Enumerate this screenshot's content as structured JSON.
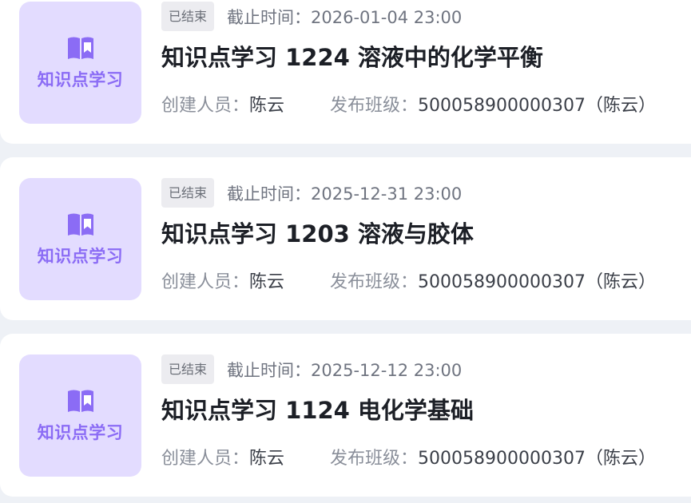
{
  "cards": [
    {
      "thumb_label": "知识点学习",
      "status": "已结束",
      "deadline_label": "截止时间：",
      "deadline": "2026-01-04 23:00",
      "title": "知识点学习 1224 溶液中的化学平衡",
      "creator_label": "创建人员：",
      "creator": "陈云",
      "class_label": "发布班级：",
      "class_value": "500058900000307（陈云）"
    },
    {
      "thumb_label": "知识点学习",
      "status": "已结束",
      "deadline_label": "截止时间：",
      "deadline": "2025-12-31 23:00",
      "title": "知识点学习 1203 溶液与胶体",
      "creator_label": "创建人员：",
      "creator": "陈云",
      "class_label": "发布班级：",
      "class_value": "500058900000307（陈云）"
    },
    {
      "thumb_label": "知识点学习",
      "status": "已结束",
      "deadline_label": "截止时间：",
      "deadline": "2025-12-12 23:00",
      "title": "知识点学习 1124 电化学基础",
      "creator_label": "创建人员：",
      "creator": "陈云",
      "class_label": "发布班级：",
      "class_value": "500058900000307（陈云）"
    }
  ],
  "colors": {
    "accent": "#8b6cf5",
    "thumb_bg": "#e3dcff",
    "badge_bg": "#ececf0",
    "page_bg": "#eef1f6"
  },
  "icons": {
    "thumb_icon": "book-icon"
  }
}
